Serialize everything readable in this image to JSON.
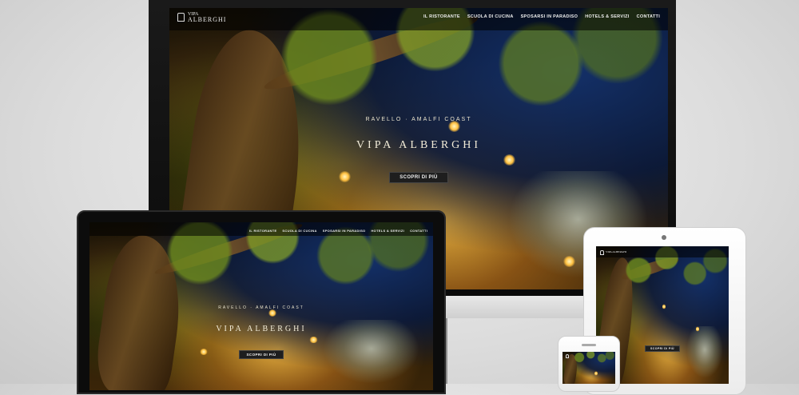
{
  "site": {
    "logo_line1": "VIPA",
    "logo_line2": "ALBERGHI",
    "nav": [
      "IL RISTORANTE",
      "SCUOLA DI CUCINA",
      "SPOSARSI IN PARADISO",
      "HOTELS & SERVIZI",
      "CONTATTI"
    ],
    "tagline": "RAVELLO · AMALFI COAST",
    "brand": "VIPA ALBERGHI",
    "cta": "SCOPRI DI PIÙ"
  },
  "colors": {
    "background": "#dcdcdc",
    "bezel": "#0c0c0c",
    "cta_bg": "#1e1e1e",
    "sky": "#14326e",
    "warm_light": "#ffbe46"
  }
}
